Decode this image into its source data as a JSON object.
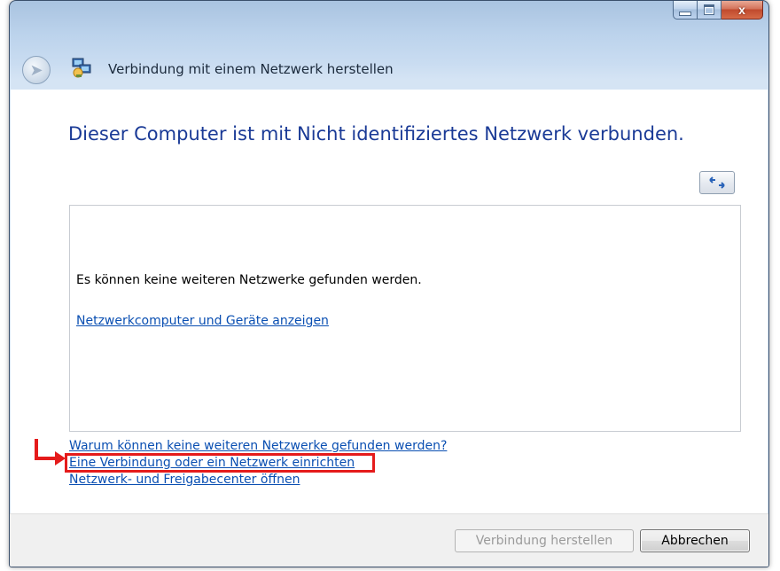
{
  "window": {
    "title": "Verbindung mit einem Netzwerk herstellen",
    "controls": {
      "minimize": "minimize",
      "maximize": "maximize",
      "close": "x"
    }
  },
  "main": {
    "heading": "Dieser Computer ist mit Nicht identifiziertes Netzwerk verbunden.",
    "refresh_icon": "refresh-arrows-icon",
    "list": {
      "empty_message": "Es können keine weiteren Netzwerke gefunden werden.",
      "link": "Netzwerkcomputer und Geräte anzeigen"
    },
    "links": [
      "Warum können keine weiteren Netzwerke gefunden werden?",
      "Eine Verbindung oder ein Netzwerk einrichten",
      "Netzwerk- und Freigabecenter öffnen"
    ],
    "highlight_color": "#e51b1b"
  },
  "footer": {
    "connect_label": "Verbindung herstellen",
    "cancel_label": "Abbrechen"
  }
}
